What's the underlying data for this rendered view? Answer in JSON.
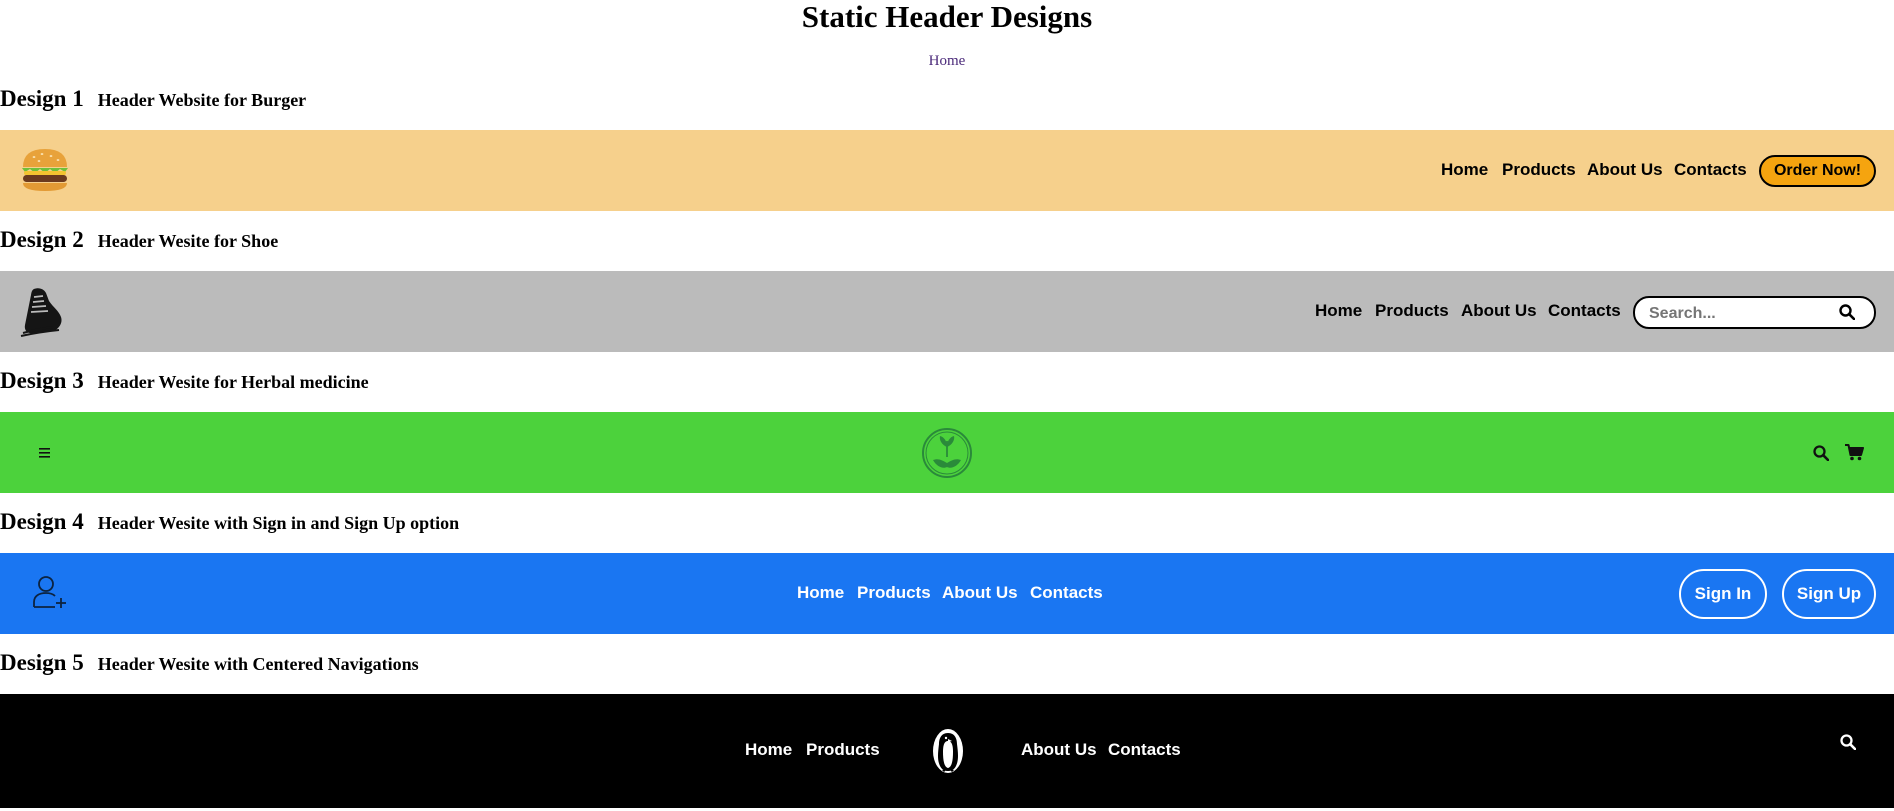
{
  "page": {
    "title": "Static Header Designs",
    "home_link": "Home"
  },
  "designs": [
    {
      "label": "Design 1",
      "subtitle": "Header Website for Burger",
      "logo_icon": "burger-icon",
      "bg": "#f6d08c",
      "nav": [
        "Home",
        "Products",
        "About Us",
        "Contacts"
      ],
      "cta": "Order Now!",
      "cta_color": "#f5a40f"
    },
    {
      "label": "Design 2",
      "subtitle": "Header Wesite for Shoe",
      "logo_icon": "shoe-icon",
      "bg": "#bbbbbb",
      "nav": [
        "Home",
        "Products",
        "About Us",
        "Contacts"
      ],
      "search_placeholder": "Search..."
    },
    {
      "label": "Design 3",
      "subtitle": "Header Wesite for Herbal medicine",
      "bg": "#4cd23c",
      "menu_icon": "hamburger-menu-icon",
      "logo_icon": "herbal-leaf-logo-icon",
      "action_icons": [
        "search-icon",
        "cart-icon"
      ]
    },
    {
      "label": "Design 4",
      "subtitle": "Header Wesite with Sign in and Sign Up option",
      "bg": "#1a76f2",
      "logo_icon": "add-user-icon",
      "nav": [
        "Home",
        "Products",
        "About Us",
        "Contacts"
      ],
      "sign_in": "Sign In",
      "sign_up": "Sign Up"
    },
    {
      "label": "Design 5",
      "subtitle": "Header Wesite with Centered Navigations",
      "bg": "#000000",
      "nav_left": [
        "Home",
        "Products"
      ],
      "nav_right": [
        "About Us",
        "Contacts"
      ],
      "logo_icon": "penguin-logo-icon",
      "action_icon": "search-icon"
    }
  ]
}
